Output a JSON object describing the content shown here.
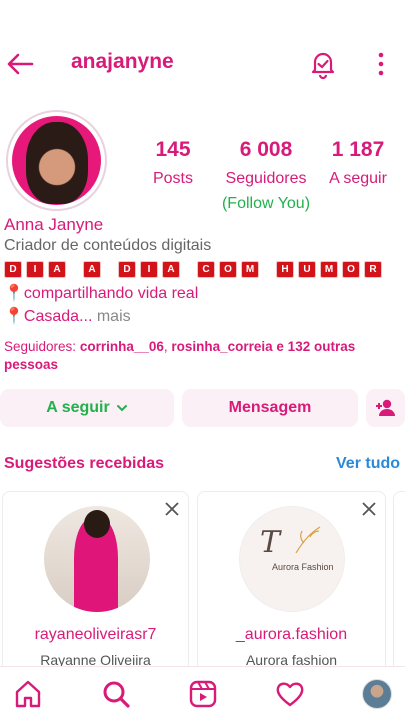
{
  "header": {
    "username": "anajanyne"
  },
  "stats": [
    {
      "value": "145",
      "label": "Posts"
    },
    {
      "value": "6 008",
      "label": "Seguidores"
    },
    {
      "value": "1 187",
      "label": "A seguir"
    }
  ],
  "follow_you": "(Follow You)",
  "profile": {
    "name": "Anna Janyne",
    "category": "Criador de conteúdos digitais",
    "tiles": [
      "D",
      "I",
      "A",
      "",
      "A",
      "",
      "D",
      "I",
      "A",
      "",
      "C",
      "O",
      "M",
      "",
      "H",
      "U",
      "M",
      "O",
      "R"
    ],
    "bio_line1": "compartilhando vida real",
    "bio_line2": "Casada...",
    "more": " mais",
    "pin": "📍"
  },
  "followed_by": {
    "prefix": "Seguidores: ",
    "user1": "corrinha__06",
    "sep": ", ",
    "user2": "rosinha_correia",
    "suffix": " e 132 outras pessoas"
  },
  "actions": {
    "follow_label": "A seguir",
    "message_label": "Mensagem"
  },
  "suggestions": {
    "title": "Sugestões recebidas",
    "see_all": "Ver tudo",
    "cards": [
      {
        "username": "rayaneoliveirasr7",
        "full_name": "Rayanne Oliveiira"
      },
      {
        "username": "_aurora.fashion",
        "full_name": "Aurora fashion",
        "logo_text": "Aurora Fashion",
        "logo_letter": "T"
      }
    ]
  },
  "colors": {
    "brand": "#d81b79",
    "green": "#22b14c",
    "link": "#2a8ad9"
  },
  "icons": [
    "back-arrow-icon",
    "bell-check-icon",
    "more-vertical-icon",
    "add-user-icon",
    "close-icon",
    "home-icon",
    "search-icon",
    "reels-icon",
    "heart-icon"
  ]
}
